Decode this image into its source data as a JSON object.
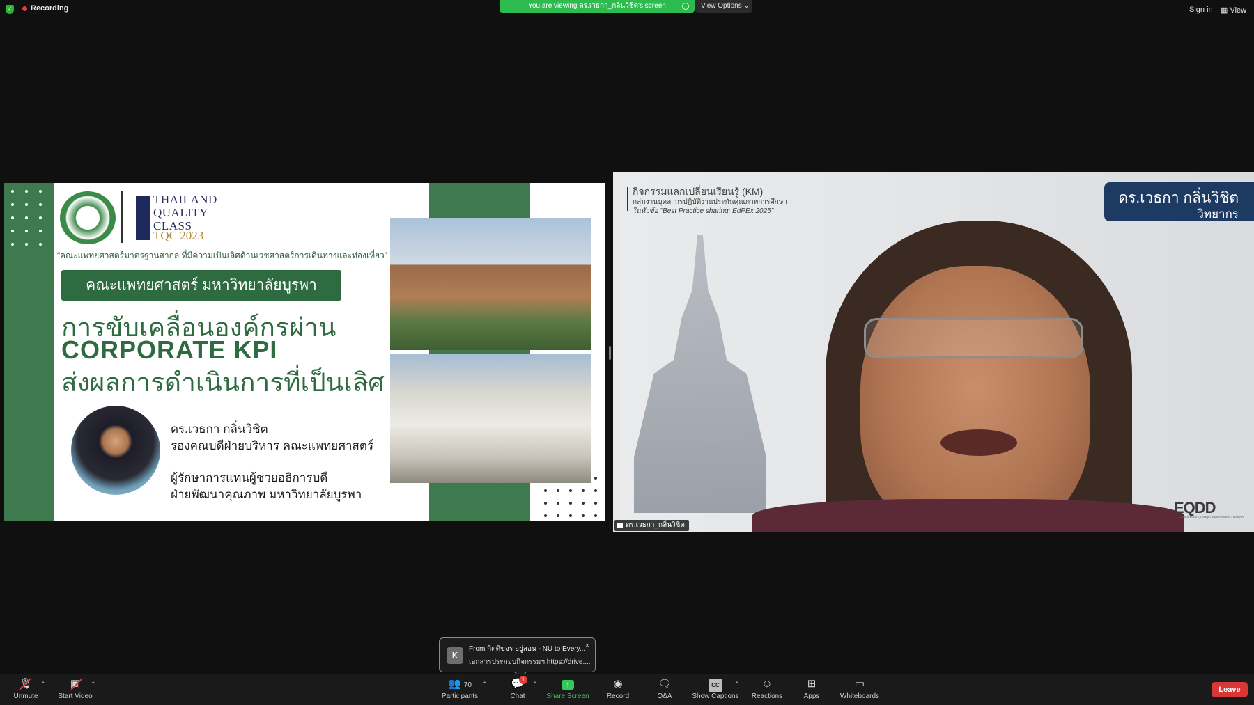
{
  "top_bar": {
    "recording_label": "Recording",
    "viewing_label": "You are viewing ดร.เวธกา_กลิ่นวิชิต's screen",
    "view_options_label": "View Options",
    "sign_in_label": "Sign in",
    "view_label": "View",
    "colors": {
      "recording_dot": "#e23c3c",
      "viewing_bg": "#2dbb4f"
    }
  },
  "slide": {
    "tqc_line1": "THAILAND",
    "tqc_line2": "QUALITY",
    "tqc_line3": "CLASS",
    "tqc_year": "TQC 2023",
    "motto": "“คณะแพทยศาสตร์มาตรฐานสากล ที่มีความเป็นเลิศด้านเวชศาสตร์การเดินทางและท่องเที่ยว”",
    "faculty": "คณะแพทยศาสตร์ มหาวิทยาลัยบูรพา",
    "headline_1": "การขับเคลื่อนองค์กรผ่าน",
    "headline_2": "CORPORATE KPI",
    "headline_3": "ส่งผลการดำเนินการที่เป็นเลิศ",
    "presenter_name": "ดร.เวธกา กลิ่นวิชิต",
    "presenter_role_1": "รองคณบดีฝ่ายบริหาร คณะแพทยศาสตร์",
    "presenter_role_2": "ผู้รักษาการแทนผู้ช่วยอธิการบดี",
    "presenter_role_3": "ฝ่ายพัฒนาคุณภาพ มหาวิทยาลัยบูรพา",
    "colors": {
      "green": "#3f7a4e",
      "dark_green": "#2f6b41"
    }
  },
  "video": {
    "km_title": "กิจกรรมแลกเปลี่ยนเรียนรู้ (KM)",
    "km_subtitle": "กลุ่มงานบุคลากรปฏิบัติงานประกันคุณภาพการศึกษา",
    "km_topic": "ในหัวข้อ \"Best Practice sharing: EdPEx 2025\"",
    "name_card_line1": "ดร.เวธกา กลิ่นวิชิต",
    "name_card_line2": "วิทยากร",
    "logo_text": "EQDD",
    "logo_subtext": "Educational Quality Development Division",
    "participant_name": "ดร.เวธกา_กลิ่นวิชิต",
    "colors": {
      "name_card_bg": "#1d3a63"
    }
  },
  "chat_popup": {
    "avatar_letter": "K",
    "from_line": "From กิตติขจร อยู่สอน - NU to Every...",
    "message_line": "เอกสารประกอบกิจกรรมฯ https://drive....",
    "close_glyph": "×"
  },
  "toolbar": {
    "unmute": "Unmute",
    "start_video": "Start Video",
    "participants": "Participants",
    "participants_count": "70",
    "chat": "Chat",
    "chat_badge": "1",
    "share_screen": "Share Screen",
    "record": "Record",
    "qa": "Q&A",
    "show_captions": "Show Captions",
    "captions_glyph": "CC",
    "reactions": "Reactions",
    "apps": "Apps",
    "whiteboards": "Whiteboards",
    "leave": "Leave",
    "colors": {
      "leave_bg": "#d93737",
      "share_green": "#34c759"
    }
  }
}
